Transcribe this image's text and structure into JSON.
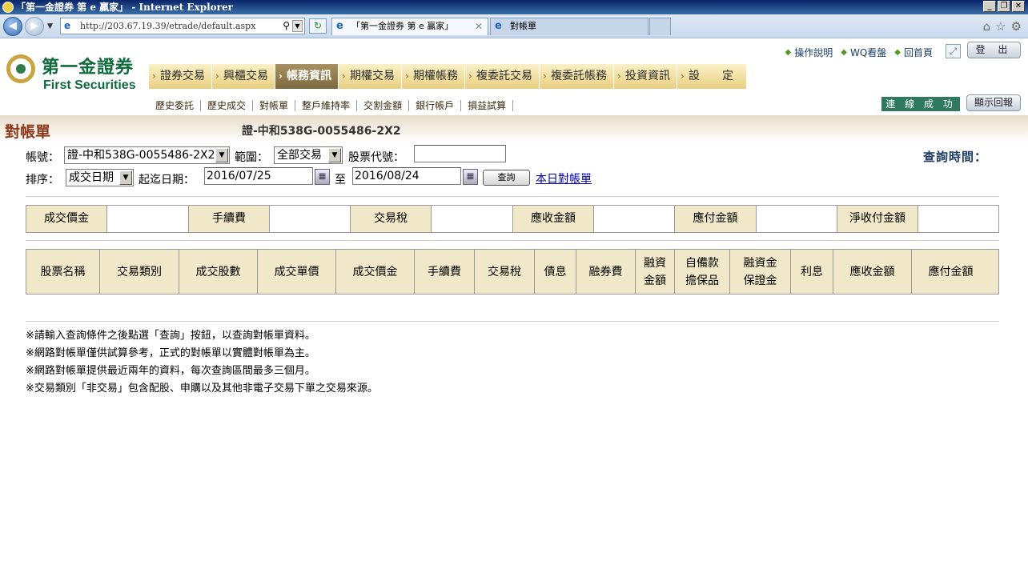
{
  "window": {
    "title": "「第一金證券 第 e 贏家」 - Internet Explorer",
    "controls": [
      "_",
      "❐",
      "✕"
    ]
  },
  "browser": {
    "url": "http://203.67.19.39/etrade/default.aspx",
    "tabs": [
      {
        "label": "「第一金證券 第 e 贏家」",
        "close": "✕"
      },
      {
        "label": "對帳單"
      }
    ]
  },
  "logo": {
    "cn": "第一金證券",
    "en": "First Securities"
  },
  "top_links": [
    "操作說明",
    "WQ看盤",
    "回首頁"
  ],
  "logout_label": "登 出",
  "main_menu": [
    "證券交易",
    "興櫃交易",
    "帳務資訊",
    "期權交易",
    "期權帳務",
    "複委託交易",
    "複委託帳務",
    "投資資訊",
    "設　　定"
  ],
  "sub_menu": [
    "歷史委託",
    "歷史成交",
    "對帳單",
    "整戶維持率",
    "交割金額",
    "銀行帳戶",
    "損益試算"
  ],
  "connection_status": "連 線 成 功",
  "report_button": "顯示回報",
  "page": {
    "title": "對帳單",
    "account_heading": "證-中和538G-0055486-2X2"
  },
  "form": {
    "account_label": "帳號：",
    "account_value": "證-中和538G-0055486-2X2",
    "range_label": "範圍：",
    "range_value": "全部交易",
    "stock_code_label": "股票代號：",
    "stock_code_value": "",
    "sort_label": "排序：",
    "sort_value": "成交日期",
    "date_label": "起迄日期：",
    "start_date": "2016/07/25",
    "to_label": "至",
    "end_date": "2016/08/24",
    "query_button": "查詢",
    "today_link": "本日對帳單",
    "query_time_label": "查詢時間："
  },
  "summary": {
    "headers": [
      "成交價金",
      "手續費",
      "交易稅",
      "應收金額",
      "應付金額",
      "淨收付金額"
    ],
    "values": [
      "",
      "",
      "",
      "",
      "",
      ""
    ]
  },
  "detail_headers": [
    [
      "股票名稱"
    ],
    [
      "交易類別"
    ],
    [
      "成交股數"
    ],
    [
      "成交單價"
    ],
    [
      "成交價金"
    ],
    [
      "手續費"
    ],
    [
      "交易稅"
    ],
    [
      "債息"
    ],
    [
      "融券費"
    ],
    [
      "融資",
      "金額"
    ],
    [
      "自備款",
      "擔保品"
    ],
    [
      "融資金",
      "保證金"
    ],
    [
      "利息"
    ],
    [
      "應收金額"
    ],
    [
      "應付金額"
    ]
  ],
  "notes": [
    "※請輸入查詢條件之後點選「查詢」按鈕，以查詢對帳單資料。",
    "※網路對帳單僅供試算參考，正式的對帳單以實體對帳單為主。",
    "※網路對帳單提供最近兩年的資料，每次查詢區間最多三個月。",
    "※交易類別「非交易」包含配股、申購以及其他非電子交易下單之交易來源。"
  ]
}
